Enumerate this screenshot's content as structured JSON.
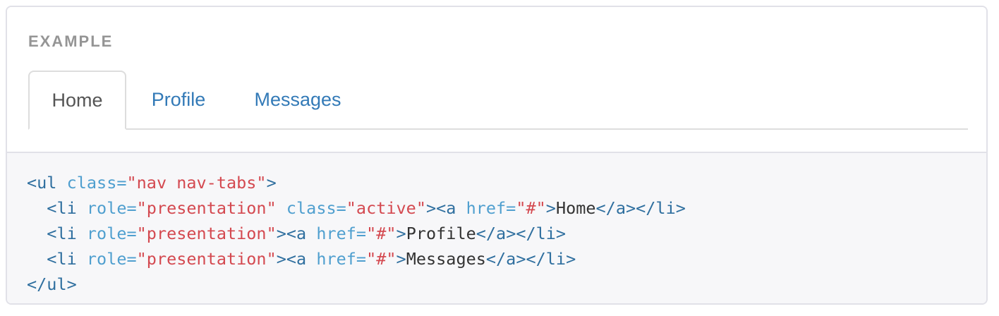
{
  "example": {
    "label": "EXAMPLE",
    "tabs": [
      {
        "label": "Home",
        "active": true
      },
      {
        "label": "Profile",
        "active": false
      },
      {
        "label": "Messages",
        "active": false
      }
    ]
  },
  "code": {
    "lines": [
      [
        {
          "t": "tag",
          "v": "<ul"
        },
        {
          "t": "txt",
          "v": " "
        },
        {
          "t": "attr",
          "v": "class="
        },
        {
          "t": "str",
          "v": "\"nav nav-tabs\""
        },
        {
          "t": "tag",
          "v": ">"
        }
      ],
      [
        {
          "t": "txt",
          "v": "  "
        },
        {
          "t": "tag",
          "v": "<li"
        },
        {
          "t": "txt",
          "v": " "
        },
        {
          "t": "attr",
          "v": "role="
        },
        {
          "t": "str",
          "v": "\"presentation\""
        },
        {
          "t": "txt",
          "v": " "
        },
        {
          "t": "attr",
          "v": "class="
        },
        {
          "t": "str",
          "v": "\"active\""
        },
        {
          "t": "tag",
          "v": "><a"
        },
        {
          "t": "txt",
          "v": " "
        },
        {
          "t": "attr",
          "v": "href="
        },
        {
          "t": "str",
          "v": "\"#\""
        },
        {
          "t": "tag",
          "v": ">"
        },
        {
          "t": "txt",
          "v": "Home"
        },
        {
          "t": "tag",
          "v": "</a></li>"
        }
      ],
      [
        {
          "t": "txt",
          "v": "  "
        },
        {
          "t": "tag",
          "v": "<li"
        },
        {
          "t": "txt",
          "v": " "
        },
        {
          "t": "attr",
          "v": "role="
        },
        {
          "t": "str",
          "v": "\"presentation\""
        },
        {
          "t": "tag",
          "v": "><a"
        },
        {
          "t": "txt",
          "v": " "
        },
        {
          "t": "attr",
          "v": "href="
        },
        {
          "t": "str",
          "v": "\"#\""
        },
        {
          "t": "tag",
          "v": ">"
        },
        {
          "t": "txt",
          "v": "Profile"
        },
        {
          "t": "tag",
          "v": "</a></li>"
        }
      ],
      [
        {
          "t": "txt",
          "v": "  "
        },
        {
          "t": "tag",
          "v": "<li"
        },
        {
          "t": "txt",
          "v": " "
        },
        {
          "t": "attr",
          "v": "role="
        },
        {
          "t": "str",
          "v": "\"presentation\""
        },
        {
          "t": "tag",
          "v": "><a"
        },
        {
          "t": "txt",
          "v": " "
        },
        {
          "t": "attr",
          "v": "href="
        },
        {
          "t": "str",
          "v": "\"#\""
        },
        {
          "t": "tag",
          "v": ">"
        },
        {
          "t": "txt",
          "v": "Messages"
        },
        {
          "t": "tag",
          "v": "</a></li>"
        }
      ],
      [
        {
          "t": "tag",
          "v": "</ul>"
        }
      ]
    ]
  },
  "colors": {
    "link": "#337ab7",
    "active_tab_text": "#555555",
    "label": "#959595",
    "code_bg": "#f7f7f9",
    "code_tag": "#2f6f9f",
    "code_attr": "#4f9fcf",
    "code_string": "#d44950"
  }
}
